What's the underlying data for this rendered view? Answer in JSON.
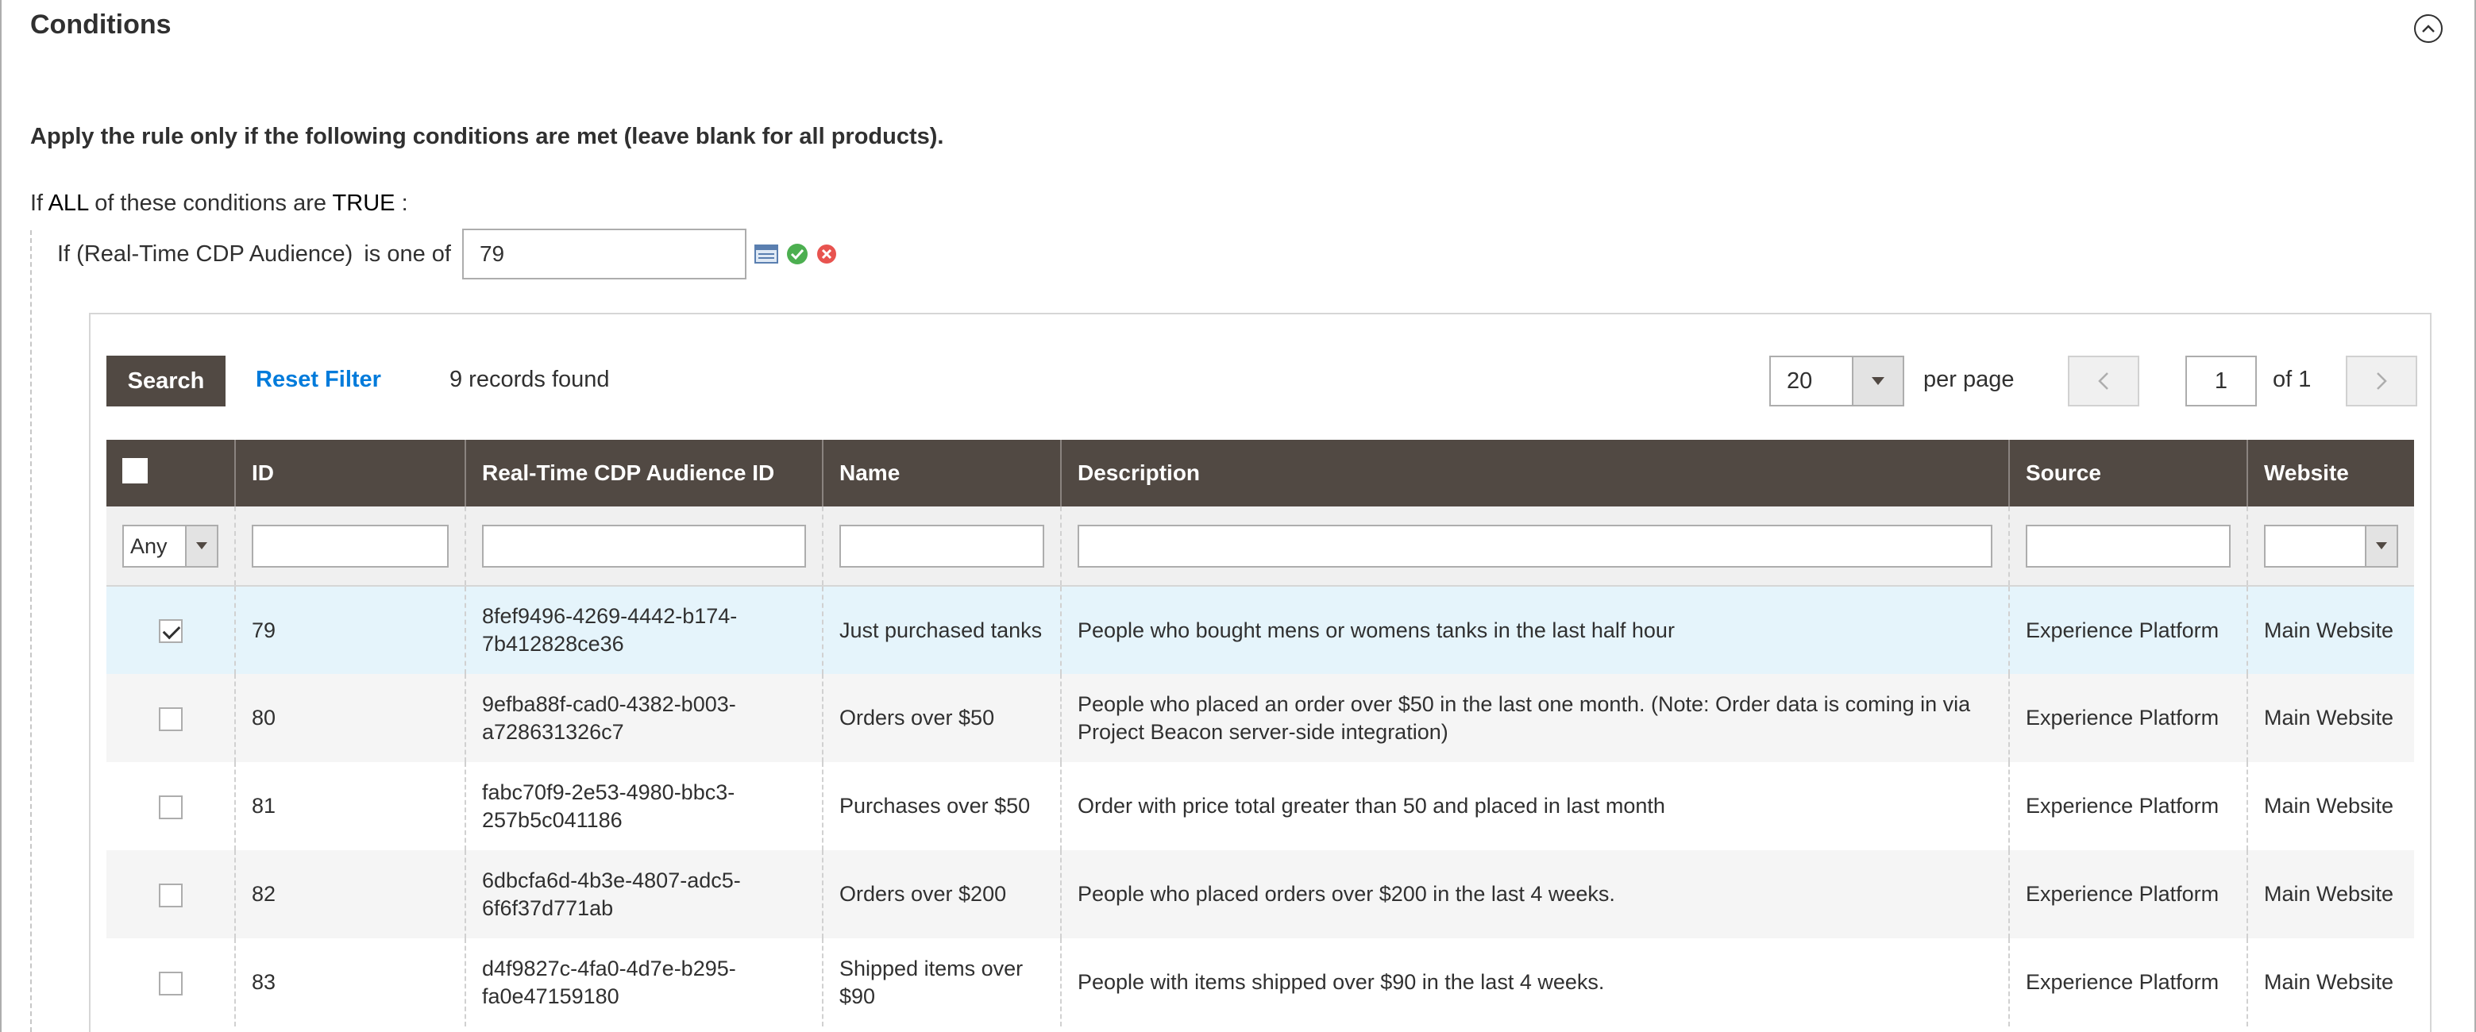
{
  "section": {
    "title": "Conditions"
  },
  "intro_text": "Apply the rule only if the following conditions are met (leave blank for all products).",
  "condition_line": {
    "prefix": "If",
    "aggregator": "ALL",
    "middle": "of these conditions are",
    "value": "TRUE",
    "suffix": ":"
  },
  "rule": {
    "attribute": "If (Real-Time CDP Audience)",
    "operator": "is one of",
    "value": "79"
  },
  "toolbar": {
    "search_label": "Search",
    "reset_label": "Reset Filter",
    "records_text": "9 records found",
    "per_page_value": "20",
    "per_page_label": "per page",
    "page_value": "1",
    "page_of": "of 1"
  },
  "columns": {
    "id": "ID",
    "audience_id": "Real-Time CDP Audience ID",
    "name": "Name",
    "description": "Description",
    "source": "Source",
    "website": "Website"
  },
  "filters": {
    "in_grid_value": "Any"
  },
  "rows": [
    {
      "checked": true,
      "id": "79",
      "audience_id": "8fef9496-4269-4442-b174-7b412828ce36",
      "name": "Just purchased tanks",
      "description": "People who bought mens or womens tanks in the last half hour",
      "source": "Experience Platform",
      "website": "Main Website"
    },
    {
      "checked": false,
      "id": "80",
      "audience_id": "9efba88f-cad0-4382-b003-a728631326c7",
      "name": "Orders over $50",
      "description": "People who placed an order over $50 in the last one month. (Note: Order data is coming in via Project Beacon server-side integration)",
      "source": "Experience Platform",
      "website": "Main Website"
    },
    {
      "checked": false,
      "id": "81",
      "audience_id": "fabc70f9-2e53-4980-bbc3-257b5c041186",
      "name": "Purchases over $50",
      "description": "Order with price total greater than 50 and placed in last month",
      "source": "Experience Platform",
      "website": "Main Website"
    },
    {
      "checked": false,
      "id": "82",
      "audience_id": "6dbcfa6d-4b3e-4807-adc5-6f6f37d771ab",
      "name": "Orders over $200",
      "description": "People who placed orders over $200 in the last 4 weeks.",
      "source": "Experience Platform",
      "website": "Main Website"
    },
    {
      "checked": false,
      "id": "83",
      "audience_id": "d4f9827c-4fa0-4d7e-b295-fa0e47159180",
      "name": "Shipped items over $90",
      "description": "People with items shipped over $90 in the last 4 weeks.",
      "source": "Experience Platform",
      "website": "Main Website"
    }
  ],
  "colors": {
    "header_bg": "#514943",
    "link": "#007bdb",
    "selected_row": "#e5f4fb"
  }
}
